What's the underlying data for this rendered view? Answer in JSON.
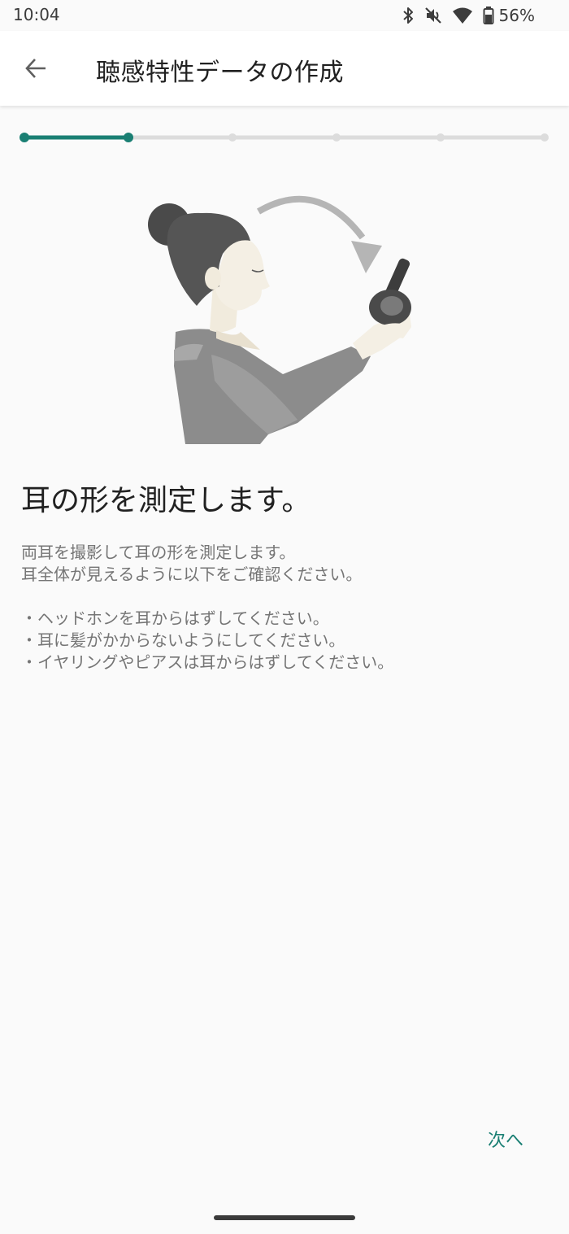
{
  "status_bar": {
    "time": "10:04",
    "battery_percent": "56%",
    "icons": [
      "bluetooth-icon",
      "vibrate-off-icon",
      "wifi-icon",
      "battery-icon"
    ]
  },
  "app_bar": {
    "title": "聴感特性データの作成",
    "back_icon": "arrow-back-icon"
  },
  "progress": {
    "total_steps": 6,
    "current_step": 2,
    "accent_color": "#1a7f73",
    "inactive_color": "#dcdcdc"
  },
  "content": {
    "headline": "耳の形を測定します。",
    "description_lines": [
      "両耳を撮影して耳の形を測定します。",
      "耳全体が見えるように以下をご確認ください。"
    ],
    "bullets": [
      "・ヘッドホンを耳からはずしてください。",
      "・耳に髪がかからないようにしてください。",
      "・イヤリングやピアスは耳からはずしてください。"
    ]
  },
  "footer": {
    "next_label": "次へ"
  },
  "colors": {
    "background": "#fafafa",
    "accent": "#1a7f73",
    "text_primary": "#212121",
    "text_secondary": "#757575"
  }
}
